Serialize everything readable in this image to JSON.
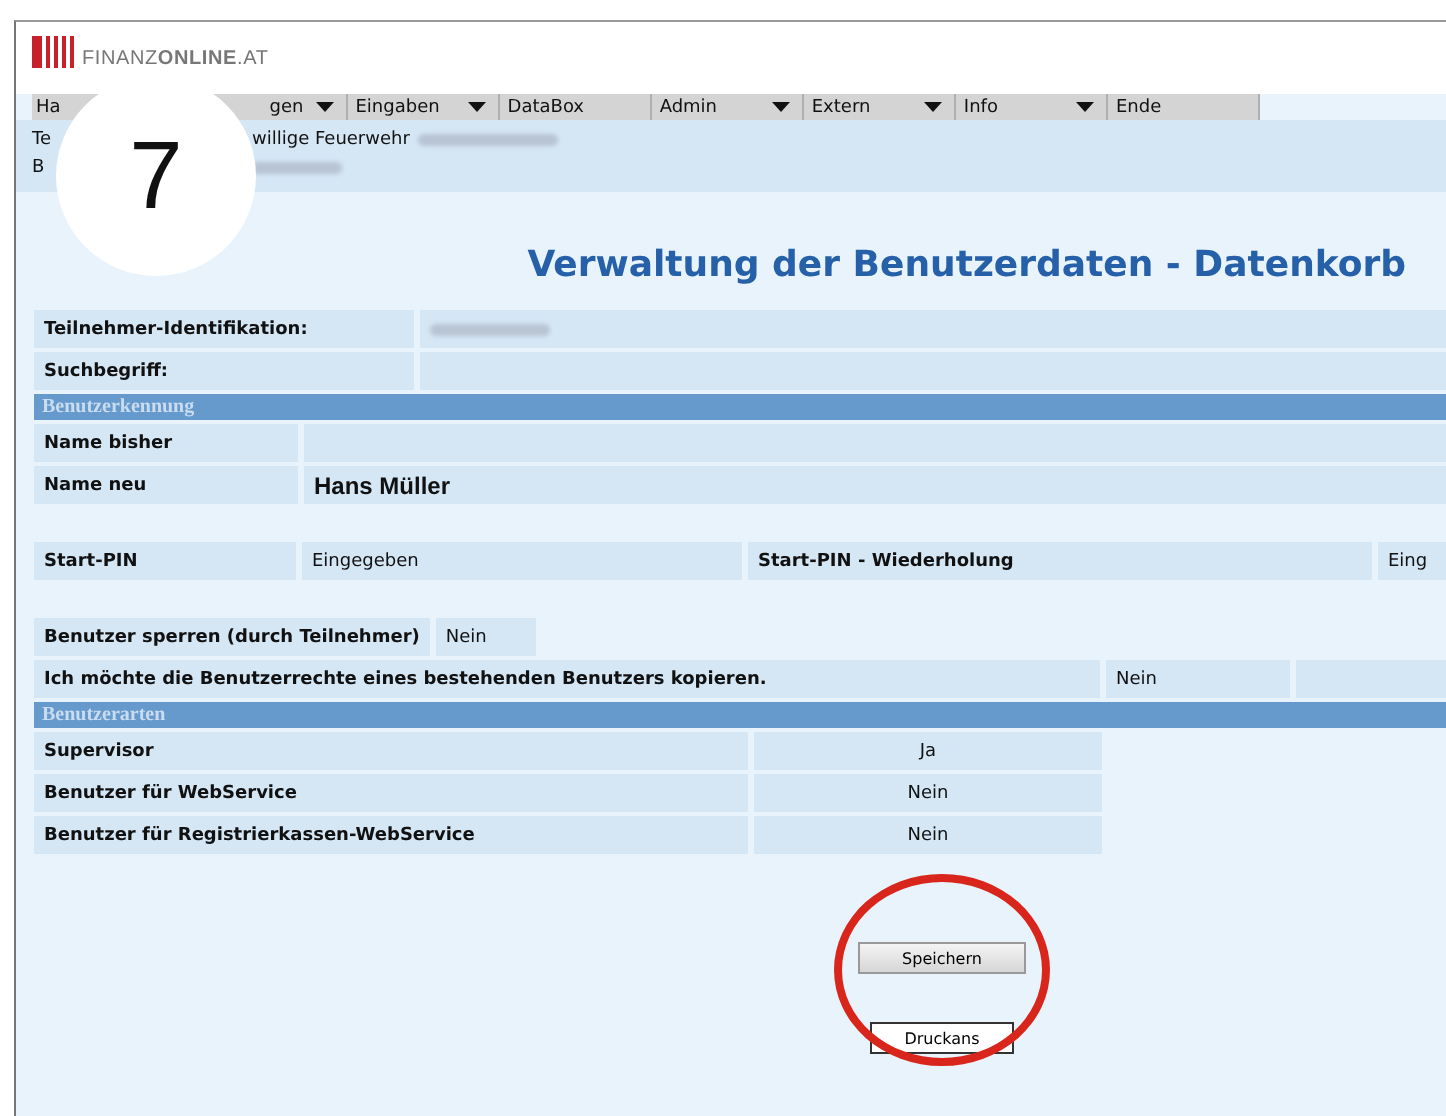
{
  "logo": "FINANZ**ONLINE**.AT",
  "menu": [
    {
      "label": "Ha",
      "dropdown": false
    },
    {
      "label": "gen",
      "dropdown": true
    },
    {
      "label": "Eingaben",
      "dropdown": true
    },
    {
      "label": "DataBox",
      "dropdown": false
    },
    {
      "label": "Admin",
      "dropdown": true
    },
    {
      "label": "Extern",
      "dropdown": true
    },
    {
      "label": "Info",
      "dropdown": true
    },
    {
      "label": "Ende",
      "dropdown": false
    }
  ],
  "info_lines": [
    {
      "start": "Te",
      "rest": "willige Feuerwehr"
    },
    {
      "start": "B"
    }
  ],
  "step_badge": "7",
  "title": "Verwaltung der Benutzerdaten - Datenkorb",
  "identity": [
    {
      "label": "Teilnehmer-Identifikation:",
      "redacted": true
    },
    {
      "label": "Suchbegriff:",
      "redacted": false
    }
  ],
  "section_user_id": "Benutzerkennung",
  "names": [
    {
      "label": "Name bisher"
    },
    {
      "label": "Name neu",
      "value": "Hans Müller"
    }
  ],
  "pin": {
    "label": "Start-PIN",
    "value": "Eingegeben",
    "repeat_label": "Start-PIN - Wiederholung",
    "repeat_value": "Eing"
  },
  "lock": {
    "label": "Benutzer sperren (durch Teilnehmer)",
    "value": "Nein"
  },
  "copy": {
    "label": "Ich möchte die Benutzerrechte eines bestehenden Benutzers kopieren.",
    "value": "Nein"
  },
  "section_user_types": "Benutzerarten",
  "user_types": [
    {
      "label": "Supervisor",
      "value": "Ja"
    },
    {
      "label": "Benutzer für WebService",
      "value": "Nein"
    },
    {
      "label": "Benutzer für Registrierkassen-WebService",
      "value": "Nein"
    }
  ],
  "save_button": "Speichern",
  "print_button": "Druckans"
}
